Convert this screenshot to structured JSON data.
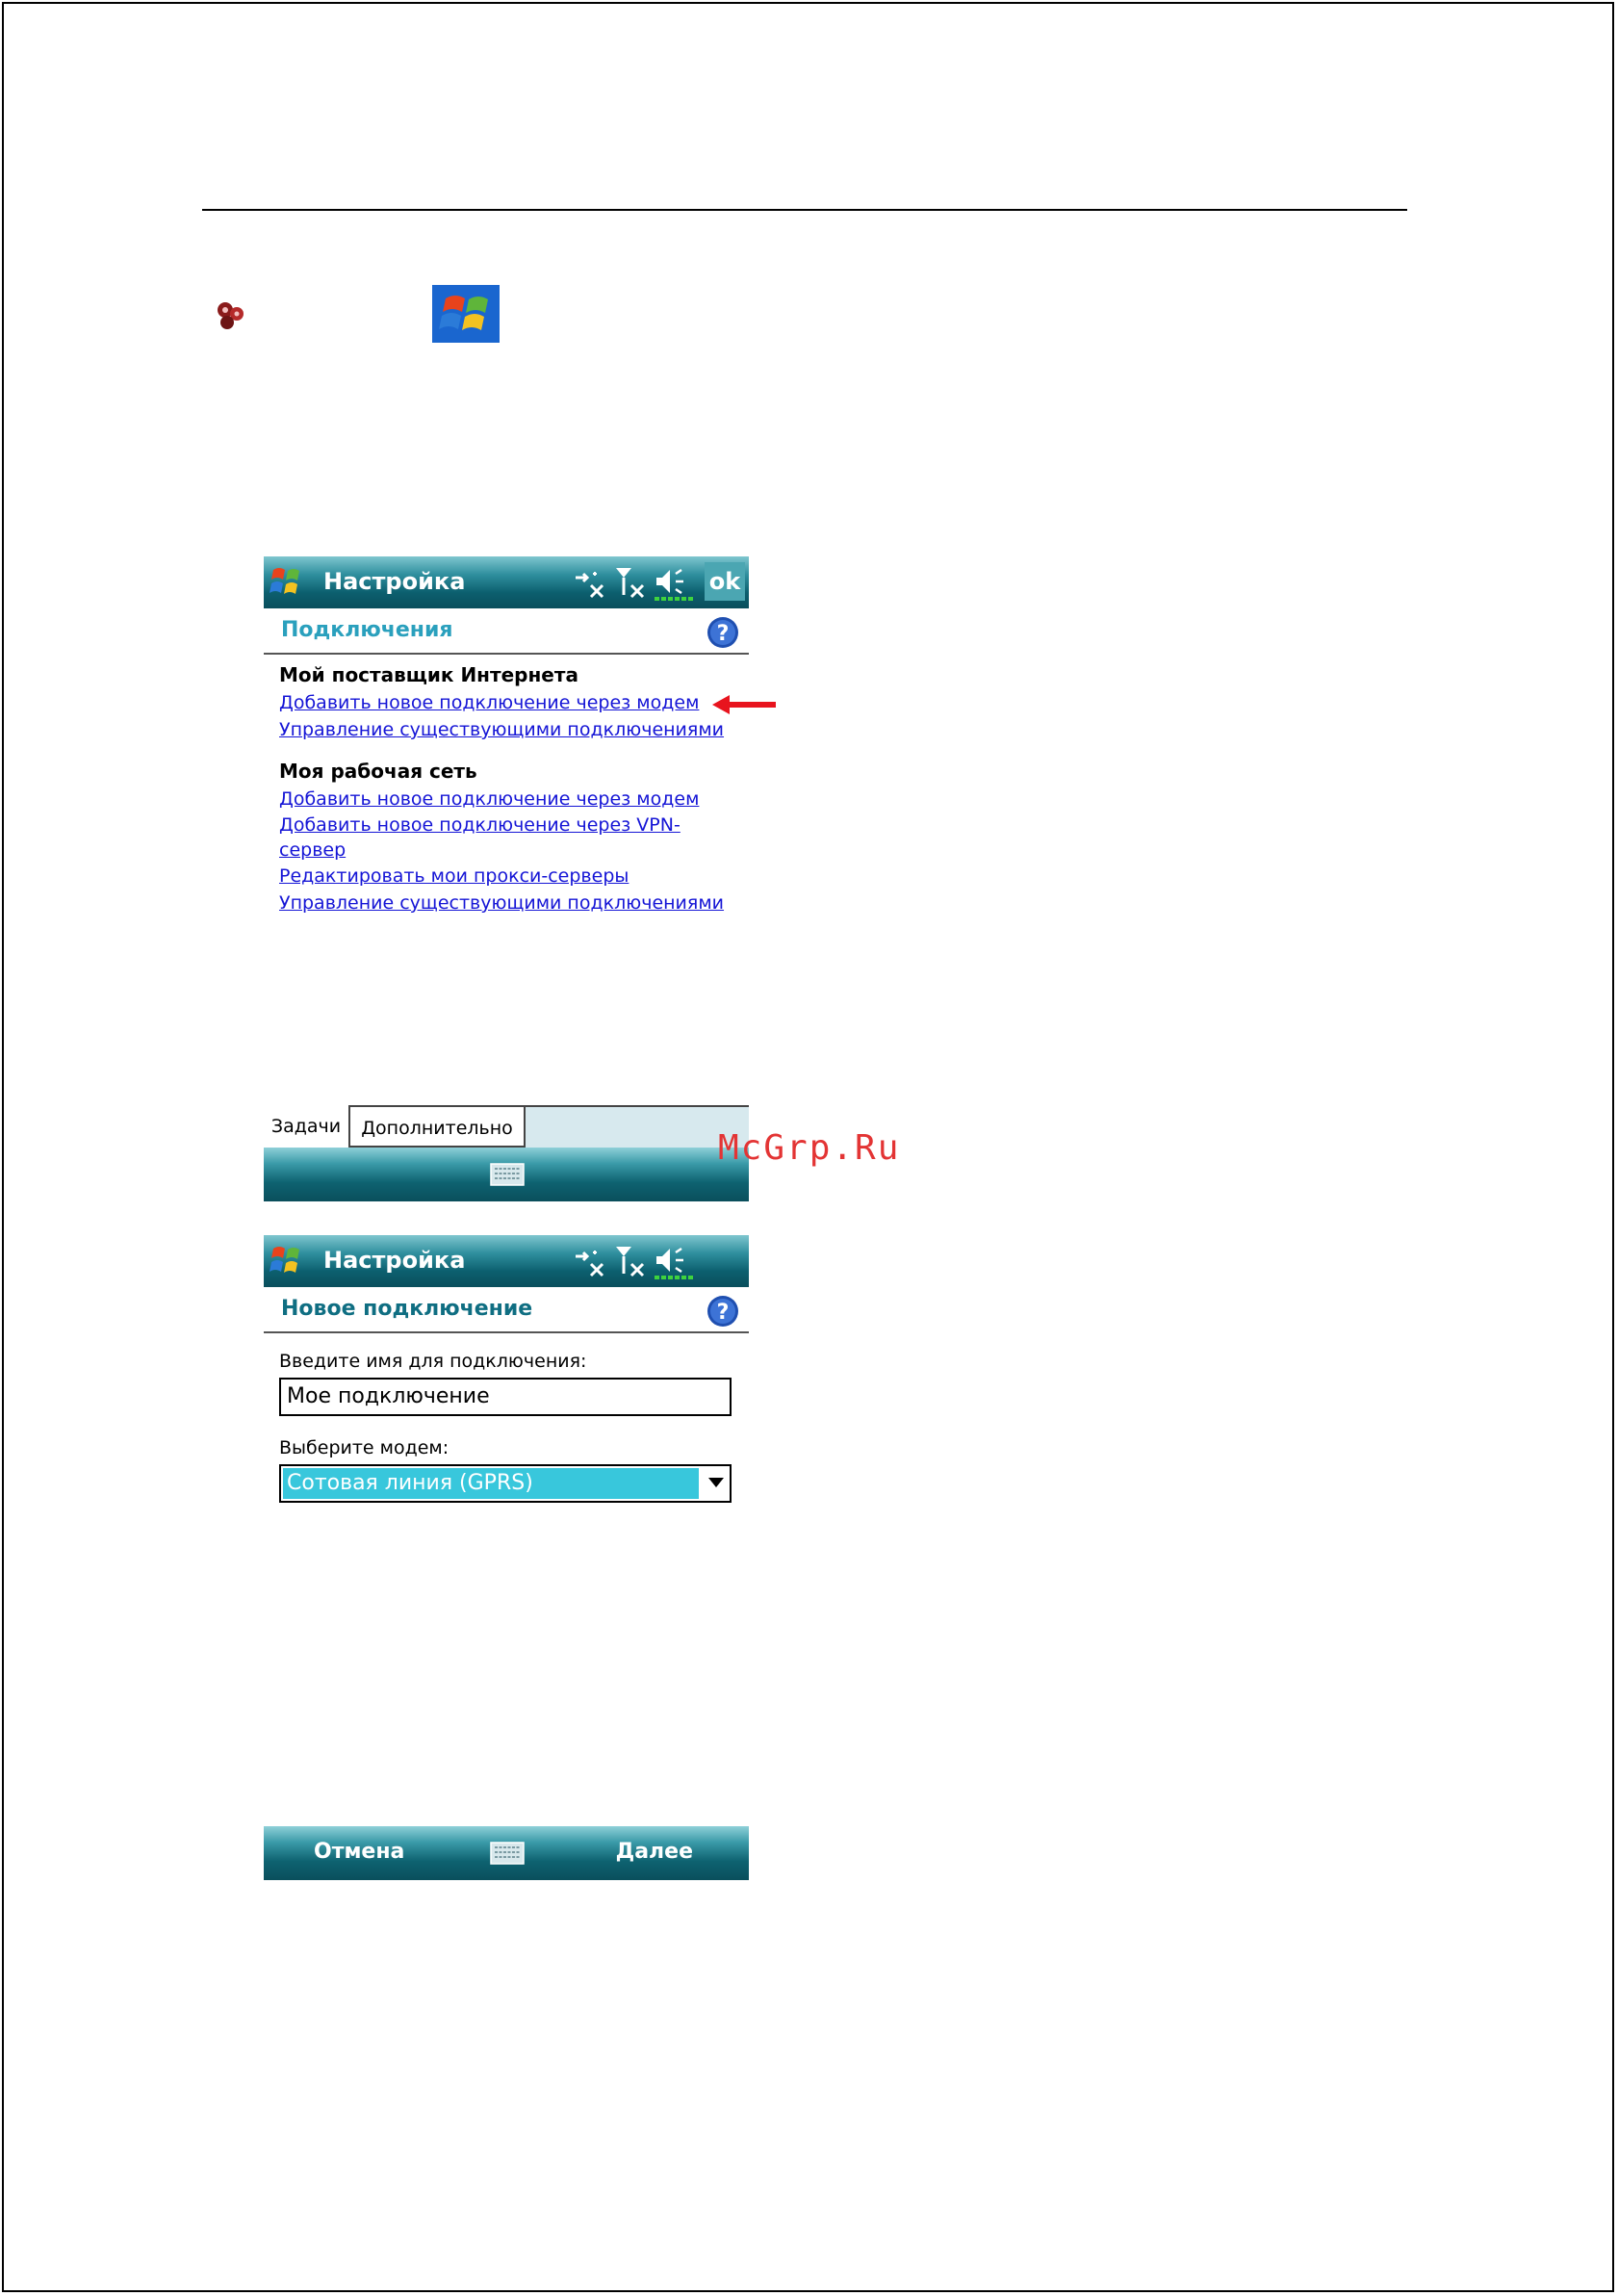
{
  "screen1": {
    "titlebar": {
      "title": "Настройка",
      "ok_label": "ok"
    },
    "header": {
      "title": "Подключения"
    },
    "sections": [
      {
        "title": "Мой поставщик Интернета",
        "links": [
          "Добавить новое подключение через модем",
          "Управление существующими подключениями"
        ]
      },
      {
        "title": "Моя рабочая сеть",
        "links": [
          "Добавить новое подключение через модем",
          "Добавить новое подключение через VPN-",
          "сервер",
          "Редактировать мои прокси-серверы",
          "Управление существующими подключениями"
        ]
      }
    ],
    "tabs": [
      "Задачи",
      "Дополнительно"
    ]
  },
  "screen2": {
    "titlebar": {
      "title": "Настройка"
    },
    "header": {
      "title": "Новое подключение"
    },
    "name_label": "Введите имя для подключения:",
    "name_value": "Мое подключение",
    "modem_label": "Выберите модем:",
    "modem_value": "Сотовая линия (GPRS)",
    "softkeys": {
      "left": "Отмена",
      "right": "Далее"
    }
  },
  "watermark": "McGrp.Ru",
  "colors": {
    "accent": "#2aa0bd",
    "link": "#1515d6",
    "selection": "#38c7dc",
    "arrow": "#e8141e"
  }
}
